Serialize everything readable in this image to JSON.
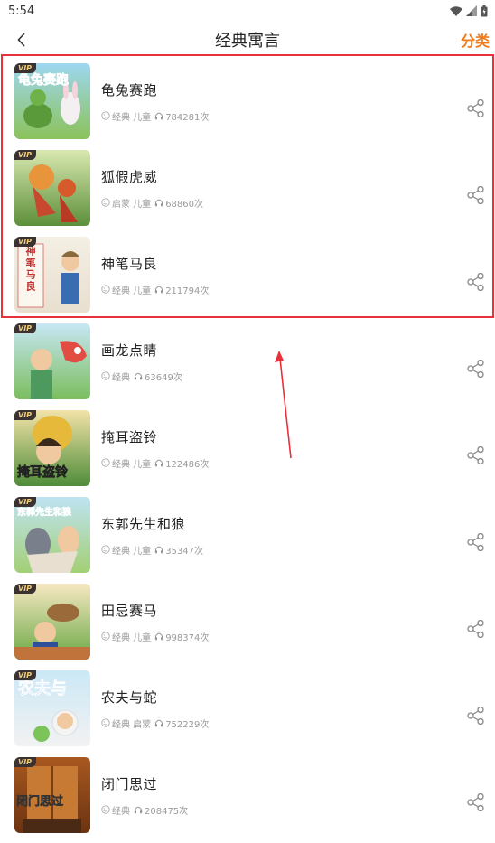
{
  "status": {
    "time": "5:54"
  },
  "header": {
    "title": "经典寓言",
    "category_label": "分类"
  },
  "accent": "#f07c1e",
  "vip_label": "VIP",
  "stories": [
    {
      "title": "龟兔赛跑",
      "tags": "经典 儿童",
      "plays": "784281次",
      "cover_text": "龟兔赛跑"
    },
    {
      "title": "狐假虎威",
      "tags": "启蒙 儿童",
      "plays": "68860次",
      "cover_text": ""
    },
    {
      "title": "神笔马良",
      "tags": "经典 儿童",
      "plays": "211794次",
      "cover_text": "神笔马良"
    },
    {
      "title": "画龙点睛",
      "tags": "经典",
      "plays": "63649次",
      "cover_text": ""
    },
    {
      "title": "掩耳盗铃",
      "tags": "经典 儿童",
      "plays": "122486次",
      "cover_text": "掩耳盗铃"
    },
    {
      "title": "东郭先生和狼",
      "tags": "经典 儿童",
      "plays": "35347次",
      "cover_text": "东郭先生和狼"
    },
    {
      "title": "田忌赛马",
      "tags": "经典 儿童",
      "plays": "998374次",
      "cover_text": ""
    },
    {
      "title": "农夫与蛇",
      "tags": "经典 启蒙",
      "plays": "752229次",
      "cover_text": "农夫与"
    },
    {
      "title": "闭门思过",
      "tags": "经典",
      "plays": "208475次",
      "cover_text": "闭门思过"
    }
  ]
}
